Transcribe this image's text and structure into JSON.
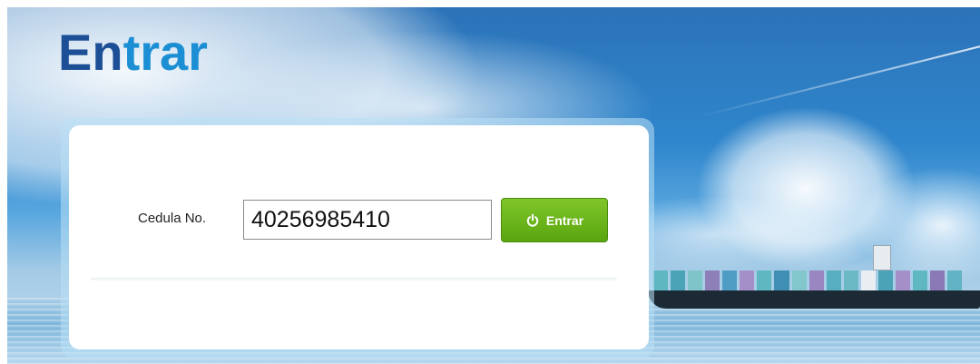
{
  "page": {
    "title_part1": "En",
    "title_part2": "trar"
  },
  "form": {
    "cedula_label": "Cedula No.",
    "cedula_value": "40256985410",
    "submit_label": "Entrar",
    "submit_icon": "power-icon"
  },
  "colors": {
    "title_dark": "#1d4f97",
    "title_light": "#1c8fd4",
    "button_green": "#6ab41e"
  }
}
